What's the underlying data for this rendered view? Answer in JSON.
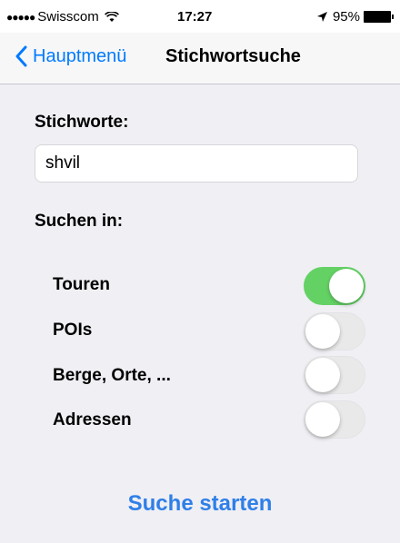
{
  "status_bar": {
    "carrier": "Swisscom",
    "time": "17:27",
    "battery": "95%"
  },
  "nav": {
    "back_label": "Hauptmenü",
    "title": "Stichwortsuche"
  },
  "form": {
    "keywords_label": "Stichworte:",
    "keywords_value": "shvil",
    "search_in_label": "Suchen in:",
    "options": [
      {
        "label": "Touren",
        "enabled": true
      },
      {
        "label": "POIs",
        "enabled": false
      },
      {
        "label": "Berge, Orte, ...",
        "enabled": false
      },
      {
        "label": "Adressen",
        "enabled": false
      }
    ]
  },
  "actions": {
    "search_button": "Suche starten"
  },
  "colors": {
    "accent": "#007aff",
    "toggle_on": "#64d164",
    "background": "#efeff4"
  }
}
